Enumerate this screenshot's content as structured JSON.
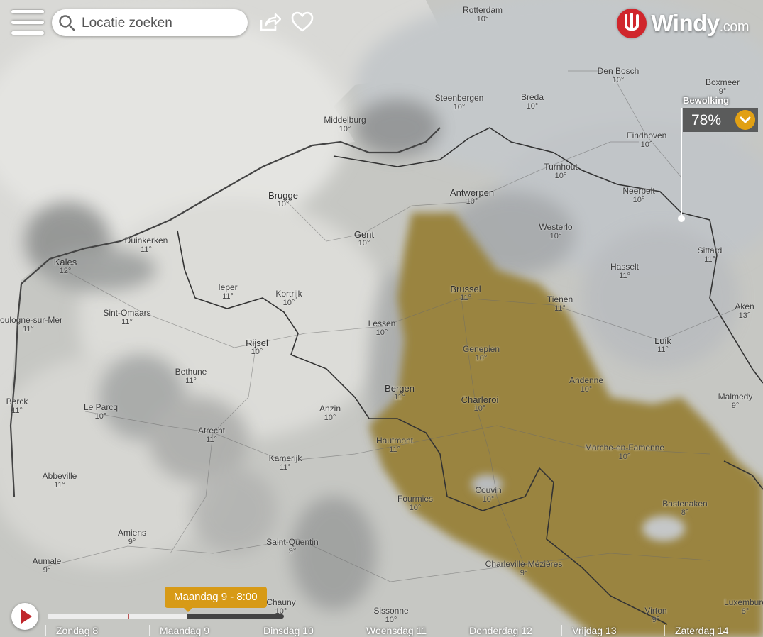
{
  "search": {
    "placeholder": "Locatie zoeken"
  },
  "brand": {
    "name": "Windy",
    "suffix": ".com"
  },
  "layer": {
    "name": "Bewolking",
    "value": "78%"
  },
  "timeline": {
    "current": "Maandag 9 - 8:00",
    "progress": 0.59,
    "days": [
      "Zondag 8",
      "Maandag 9",
      "Dinsdag 10",
      "Woensdag 11",
      "Donderdag 12",
      "Vrijdag 13",
      "Zaterdag 14"
    ]
  },
  "cities": [
    {
      "name": "Rotterdam",
      "temp": "10°"
    },
    {
      "name": "Den Bosch",
      "temp": "10°"
    },
    {
      "name": "Middelburg",
      "temp": "10°"
    },
    {
      "name": "Steenbergen",
      "temp": "10°"
    },
    {
      "name": "Breda",
      "temp": "10°"
    },
    {
      "name": "Eindhoven",
      "temp": "10°"
    },
    {
      "name": "Turnhout",
      "temp": "10°"
    },
    {
      "name": "Antwerpen",
      "temp": "10°"
    },
    {
      "name": "Brugge",
      "temp": "10°"
    },
    {
      "name": "Gent",
      "temp": "10°"
    },
    {
      "name": "Duinkerken",
      "temp": "11°"
    },
    {
      "name": "Kales",
      "temp": "12°"
    },
    {
      "name": "Westerlo",
      "temp": "10°"
    },
    {
      "name": "Neerpelt",
      "temp": "10°"
    },
    {
      "name": "Hasselt",
      "temp": "11°"
    },
    {
      "name": "Sittard",
      "temp": "11°"
    },
    {
      "name": "Brussel",
      "temp": "11°"
    },
    {
      "name": "Tienen",
      "temp": "11°"
    },
    {
      "name": "Ieper",
      "temp": "11°"
    },
    {
      "name": "Kortrijk",
      "temp": "10°"
    },
    {
      "name": "Sint-Omaars",
      "temp": "11°"
    },
    {
      "name": "Lessen",
      "temp": "10°"
    },
    {
      "name": "Rijsel",
      "temp": "10°"
    },
    {
      "name": "Genepien",
      "temp": "10°"
    },
    {
      "name": "Luik",
      "temp": "11°"
    },
    {
      "name": "Aken",
      "temp": "13°"
    },
    {
      "name": "Bethune",
      "temp": "11°"
    },
    {
      "name": "Bergen",
      "temp": "11°"
    },
    {
      "name": "Andenne",
      "temp": "10°"
    },
    {
      "name": "Charleroi",
      "temp": "10°"
    },
    {
      "name": "Malmedy",
      "temp": "9°"
    },
    {
      "name": "Le Parcq",
      "temp": "10°"
    },
    {
      "name": "Anzin",
      "temp": "10°"
    },
    {
      "name": "Atrecht",
      "temp": "11°"
    },
    {
      "name": "Hautmont",
      "temp": "11°"
    },
    {
      "name": "Marche-en-Famenne",
      "temp": "10°"
    },
    {
      "name": "Kamerijk",
      "temp": "11°"
    },
    {
      "name": "Abbeville",
      "temp": "11°"
    },
    {
      "name": "Couvin",
      "temp": "10°"
    },
    {
      "name": "Fourmies",
      "temp": "10°"
    },
    {
      "name": "Bastenaken",
      "temp": "8°"
    },
    {
      "name": "Amiens",
      "temp": "9°"
    },
    {
      "name": "Saint-Quentin",
      "temp": "9°"
    },
    {
      "name": "Charleville-Mézières",
      "temp": "9°"
    },
    {
      "name": "Sissonne",
      "temp": "10°"
    },
    {
      "name": "Virton",
      "temp": "9°"
    },
    {
      "name": "Luxemburg",
      "temp": "8°"
    },
    {
      "name": "Boxmeer",
      "temp": "9°"
    },
    {
      "name": "Aumale",
      "temp": "9°"
    },
    {
      "name": "Berck",
      "temp": "11°"
    },
    {
      "name": "Boulogne-sur-Mer",
      "temp": "11°"
    },
    {
      "name": "Chauny",
      "temp": "10°"
    }
  ]
}
